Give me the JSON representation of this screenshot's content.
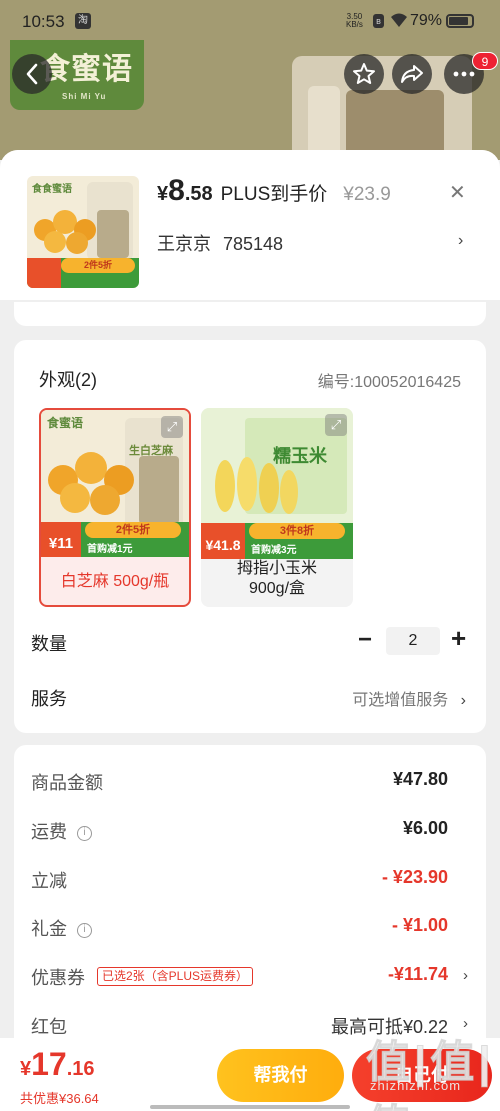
{
  "status_bar": {
    "time": "10:53",
    "app_icon": "淘",
    "net_speed_top": "3.50",
    "net_speed_bottom": "KB/s",
    "bt_icon": "bluetooth-icon",
    "battery": "79%"
  },
  "hero": {
    "brand": "食蜜语",
    "brand_sub": "Shi Mi Yu",
    "badge_count": "9"
  },
  "product": {
    "price_yen": "¥",
    "price_int": "8",
    "price_dec": ".58",
    "price_label": "PLUS到手价",
    "original_price": "¥23.9",
    "address_name": "王京京",
    "address_code": "785148"
  },
  "appearance": {
    "title": "外观(2)",
    "code": "编号:100052016425",
    "variants": [
      {
        "label": "白芝麻 500g/瓶",
        "selected": true,
        "promo_main": "2件5折",
        "promo_sub": "首购减1元",
        "promo_price": "¥11",
        "img_title": "生白芝麻",
        "logo": "食蜜语"
      },
      {
        "label": "拇指小玉米 900g/盒",
        "selected": false,
        "promo_main": "3件8折",
        "promo_sub": "首购减3元",
        "promo_price": "¥41.8",
        "img_title": "糯玉米",
        "logo": ""
      }
    ]
  },
  "quantity": {
    "label": "数量",
    "value": "2",
    "minus": "−",
    "plus": "+"
  },
  "service": {
    "label": "服务",
    "option": "可选增值服务"
  },
  "fees": {
    "goods_amount": {
      "label": "商品金额",
      "value": "¥47.80"
    },
    "shipping": {
      "label": "运费",
      "value": "¥6.00"
    },
    "instant_discount": {
      "label": "立减",
      "value": "- ¥23.90"
    },
    "gift_money": {
      "label": "礼金",
      "value": "- ¥1.00"
    },
    "coupon": {
      "label": "优惠券",
      "tag": "已选2张（含PLUS运费券）",
      "value": "-¥11.74"
    },
    "red_packet": {
      "label": "红包",
      "value": "最高可抵¥0.22"
    }
  },
  "bottom_bar": {
    "total_yen": "¥",
    "total_int": "17",
    "total_dec": ".16",
    "discount_total": "共优惠¥36.64",
    "help_pay": "帮我付",
    "self_pay": "自己付"
  },
  "watermark": {
    "big": "值|值|值",
    "small": "zhizhizhi.com"
  },
  "colors": {
    "accent_red": "#e5372b",
    "help_yellow": "#ffb414",
    "brand_green": "#5f8a3c"
  }
}
